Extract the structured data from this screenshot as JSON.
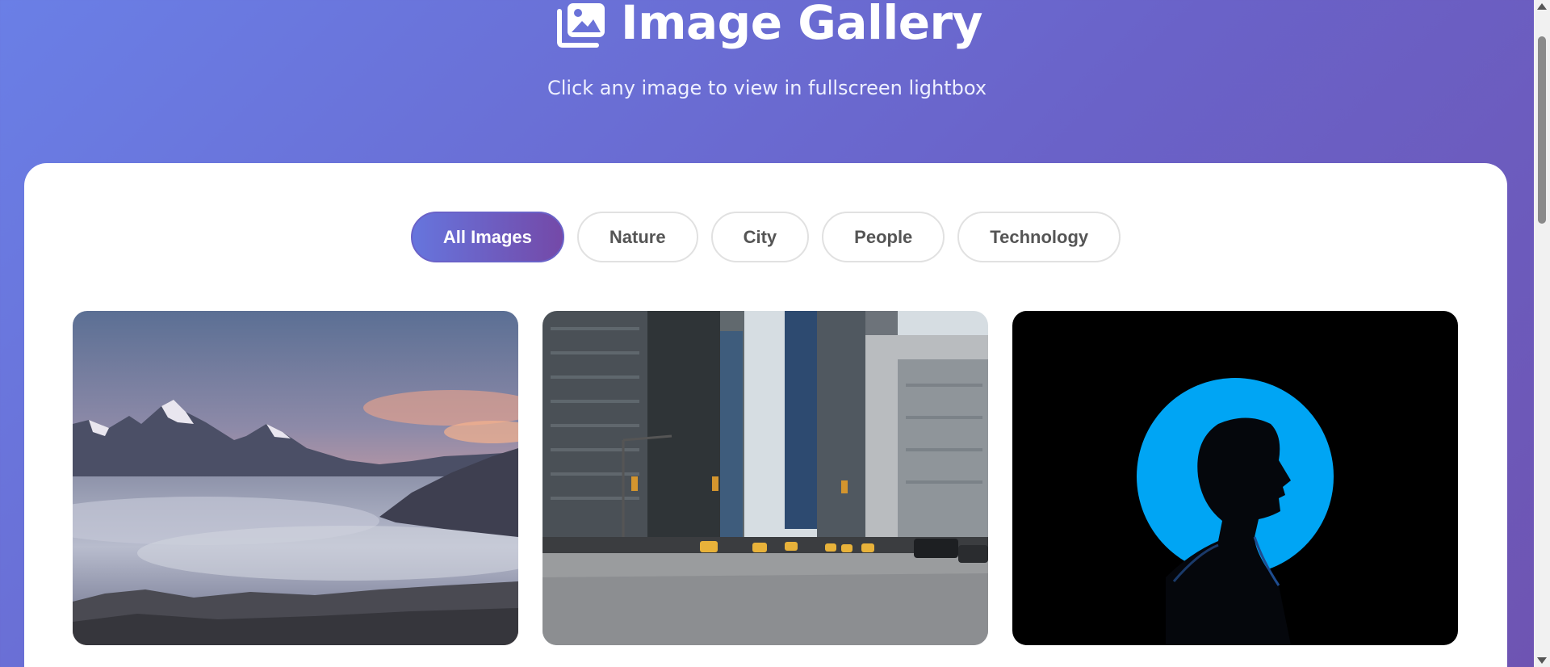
{
  "header": {
    "title": "Image Gallery",
    "subtitle": "Click any image to view in fullscreen lightbox",
    "icon": "images-icon"
  },
  "filters": [
    {
      "label": "All Images",
      "active": true
    },
    {
      "label": "Nature",
      "active": false
    },
    {
      "label": "City",
      "active": false
    },
    {
      "label": "People",
      "active": false
    },
    {
      "label": "Technology",
      "active": false
    }
  ],
  "gallery": [
    {
      "category": "Nature",
      "depicts": "mountain-sea-of-clouds-photo"
    },
    {
      "category": "City",
      "depicts": "city-street-skyscrapers-photo"
    },
    {
      "category": "People",
      "depicts": "silhouette-blue-circle-photo"
    }
  ],
  "colors": {
    "accent_start": "#6675dd",
    "accent_end": "#7449a8",
    "background_start": "#6a7fe6",
    "background_end": "#6e54b2"
  }
}
